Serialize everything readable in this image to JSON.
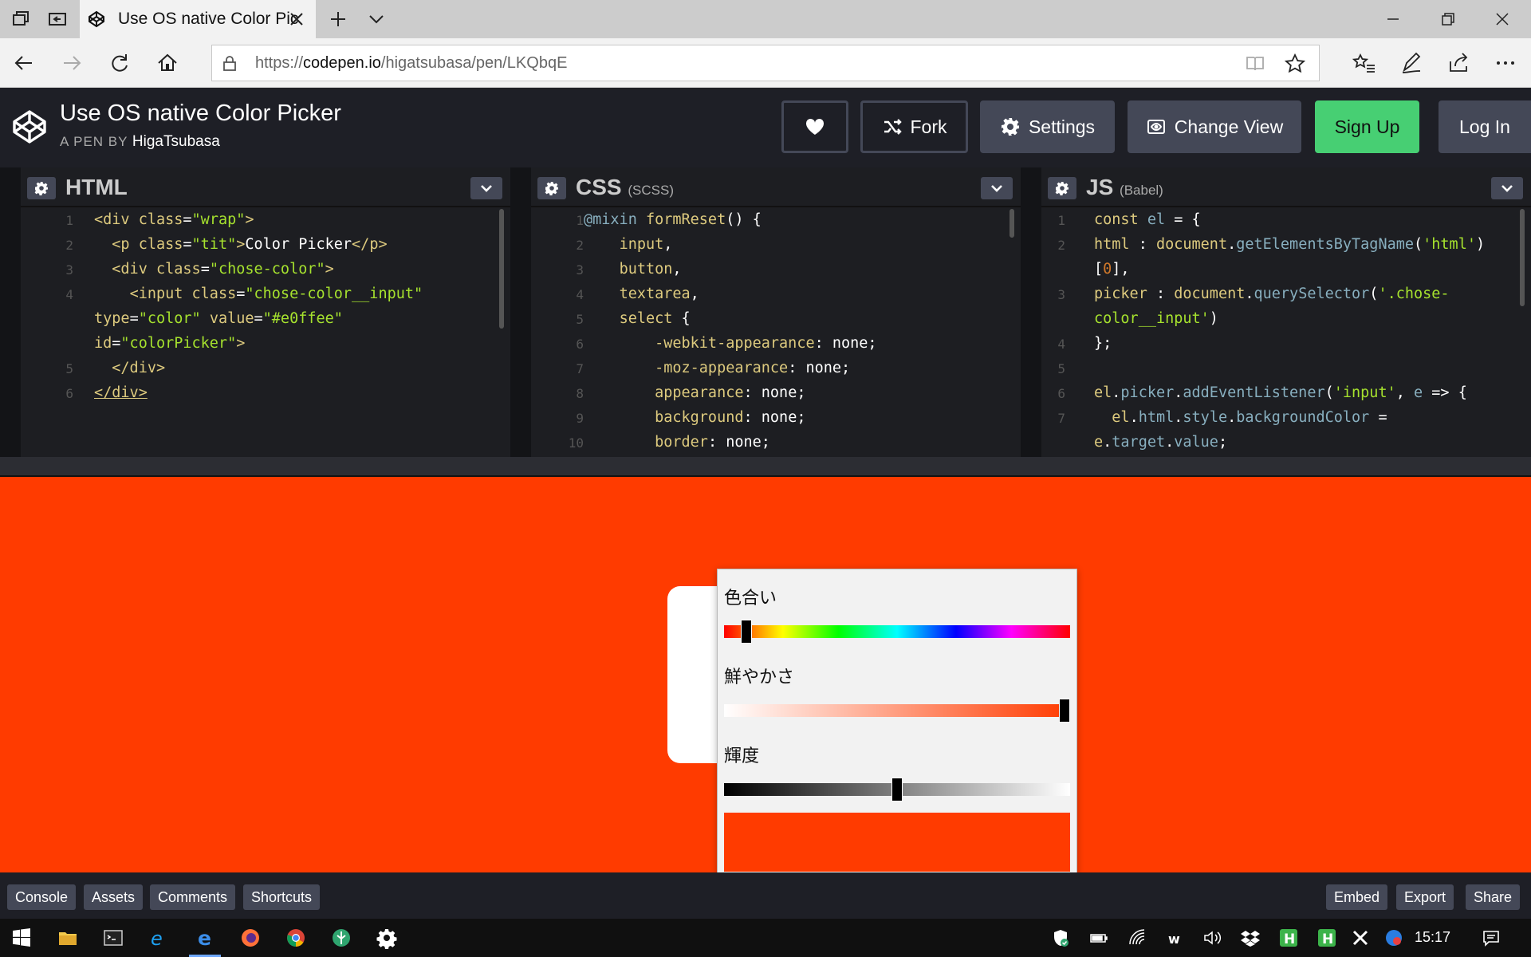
{
  "browser": {
    "tab_title": "Use OS native Color Pic",
    "url_prefix": "https://",
    "url_host": "codepen.io",
    "url_path": "/higatsubasa/pen/LKQbqE"
  },
  "header": {
    "pen_title": "Use OS native Color Picker",
    "by_label": "A PEN BY",
    "author": "HigaTsubasa",
    "fork_label": "Fork",
    "settings_label": "Settings",
    "change_view_label": "Change View",
    "signup_label": "Sign Up",
    "login_label": "Log In"
  },
  "editors": {
    "html": {
      "title": "HTML",
      "subtitle": ""
    },
    "css": {
      "title": "CSS",
      "subtitle": "(SCSS)"
    },
    "js": {
      "title": "JS",
      "subtitle": "(Babel)"
    }
  },
  "picker": {
    "hue_label": "色合い",
    "saturation_label": "鮮やかさ",
    "luminance_label": "輝度",
    "hue_value": 0.05,
    "saturation_value": 1.0,
    "luminance_value": 0.5,
    "preview_color": "#ff3b00"
  },
  "footer": {
    "console_label": "Console",
    "assets_label": "Assets",
    "comments_label": "Comments",
    "shortcuts_label": "Shortcuts",
    "embed_label": "Embed",
    "export_label": "Export",
    "share_label": "Share"
  },
  "taskbar": {
    "clock": "15:17"
  },
  "colors": {
    "preview_background": "#ff3b00",
    "signup_green": "#47cf73",
    "codepen_dark": "#1e1f26"
  }
}
